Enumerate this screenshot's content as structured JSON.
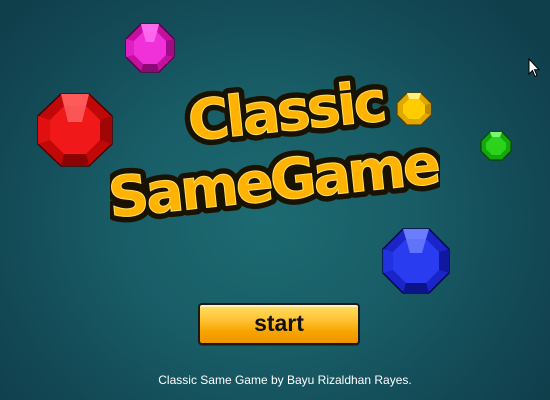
{
  "game": {
    "title_line1": "Classic",
    "title_line2": "SameGame",
    "start_label": "start",
    "credits": "Classic Same Game by Bayu Rizaldhan Rayes."
  },
  "colors": {
    "background": "#185c66",
    "title_fill": "#ffb300",
    "title_outline": "#1a1200",
    "button_fill": "#ffc233",
    "gem_magenta": "#ee22cc",
    "gem_red": "#ee1111",
    "gem_yellow": "#ffcc00",
    "gem_green": "#22cc11",
    "gem_blue": "#2233ee"
  },
  "gems": [
    {
      "name": "magenta-gem-icon",
      "color": "magenta"
    },
    {
      "name": "red-gem-icon",
      "color": "red"
    },
    {
      "name": "yellow-gem-icon",
      "color": "yellow"
    },
    {
      "name": "green-gem-icon",
      "color": "green"
    },
    {
      "name": "blue-gem-icon",
      "color": "blue"
    }
  ],
  "icons": {
    "cursor": "mouse-pointer-icon"
  }
}
